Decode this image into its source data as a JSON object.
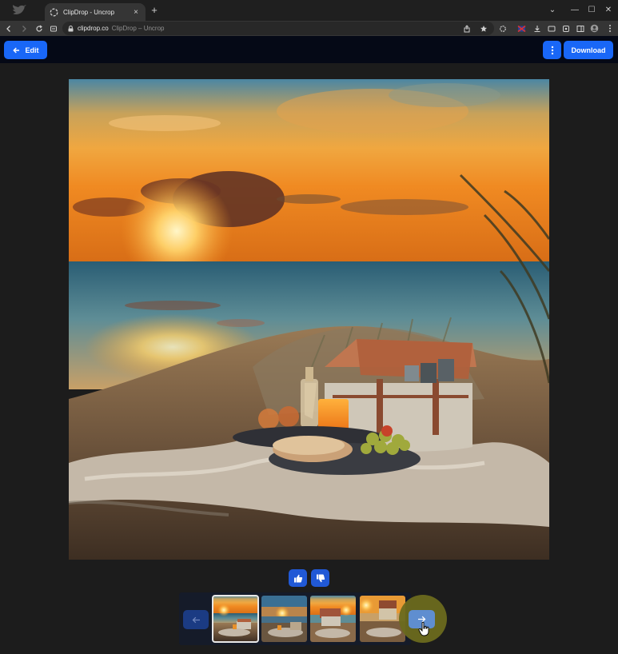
{
  "browser": {
    "tab": {
      "title": "ClipDrop - Uncrop",
      "close_glyph": "×"
    },
    "new_tab_glyph": "+",
    "address": {
      "host": "clipdrop.co",
      "page_title": "ClipDrop – Uncrop"
    },
    "window": {
      "dropdown": "⌄",
      "minimize": "—",
      "maximize": "☐",
      "close": "✕"
    }
  },
  "header": {
    "edit_label": "Edit",
    "download_label": "Download",
    "more_icon": "vertical-dots-icon"
  },
  "image": {
    "description_icon": "generated-beach-picnic-image"
  },
  "feedback": {
    "like_icon": "thumbs-up-icon",
    "dislike_icon": "thumbs-down-icon"
  },
  "carousel": {
    "prev_icon": "arrow-left-icon",
    "next_icon": "arrow-right-icon",
    "thumbnails": [
      {
        "selected": true
      },
      {
        "selected": false
      },
      {
        "selected": false
      },
      {
        "selected": false
      }
    ]
  },
  "colors": {
    "accent": "#1967f7",
    "header_bg": "#050916",
    "page_bg": "#1c1c1c",
    "cursor_highlight": "#6b6a1d"
  }
}
